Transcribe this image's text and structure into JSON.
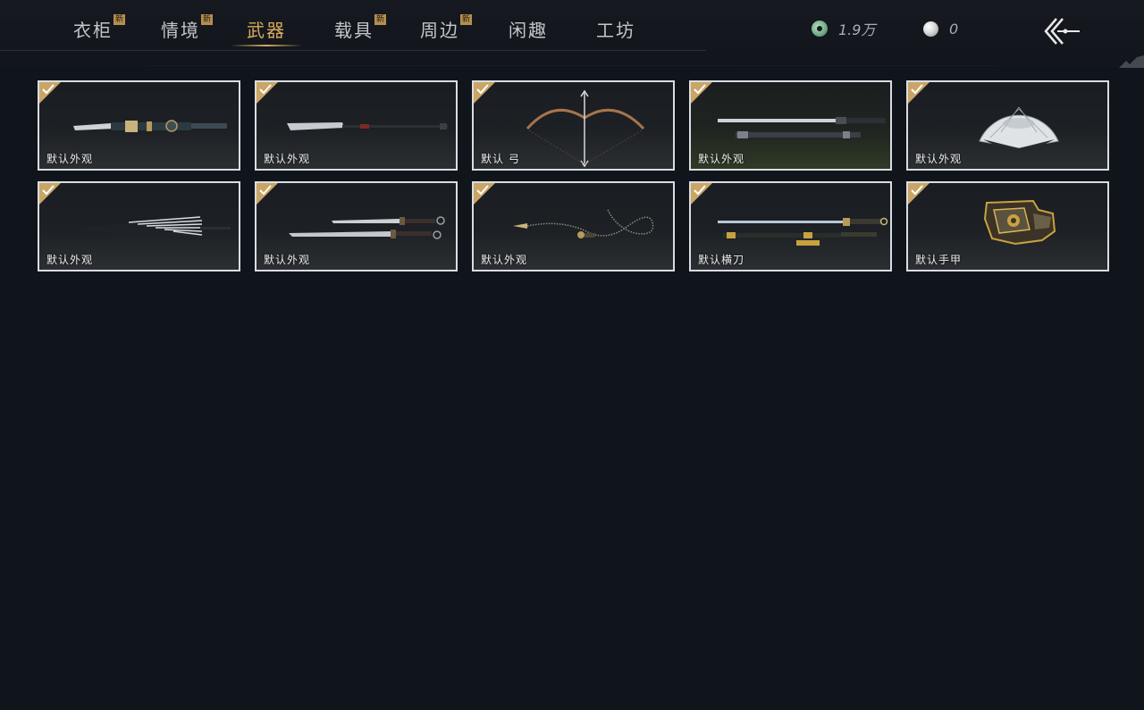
{
  "tabs": [
    {
      "label": "衣柜",
      "badge": "新"
    },
    {
      "label": "情境",
      "badge": "新"
    },
    {
      "label": "武器",
      "badge": ""
    },
    {
      "label": "载具",
      "badge": "新"
    },
    {
      "label": "周边",
      "badge": "新"
    },
    {
      "label": "闲趣",
      "badge": ""
    },
    {
      "label": "工坊",
      "badge": ""
    }
  ],
  "active_tab": "武器",
  "currency": {
    "jade": "1.9万",
    "pearl": "0"
  },
  "items": [
    {
      "label": "默认外观",
      "icon": "spear-weapon-icon"
    },
    {
      "label": "默认外观",
      "icon": "glaive-weapon-icon"
    },
    {
      "label": "默认 弓",
      "icon": "bow-weapon-icon"
    },
    {
      "label": "默认外观",
      "icon": "sword-weapon-icon"
    },
    {
      "label": "默认外观",
      "icon": "fan-weapon-icon"
    },
    {
      "label": "默认外观",
      "icon": "umbrella-weapon-icon"
    },
    {
      "label": "默认外观",
      "icon": "dual-blades-weapon-icon"
    },
    {
      "label": "默认外观",
      "icon": "rope-dart-weapon-icon"
    },
    {
      "label": "默认横刀",
      "icon": "hengdao-weapon-icon"
    },
    {
      "label": "默认手甲",
      "icon": "gauntlet-weapon-icon"
    }
  ],
  "colors": {
    "background": "#10141b",
    "accent_gold": "#d9aa5f",
    "badge": "#b58f4e",
    "card_border": "#d9dde3"
  }
}
